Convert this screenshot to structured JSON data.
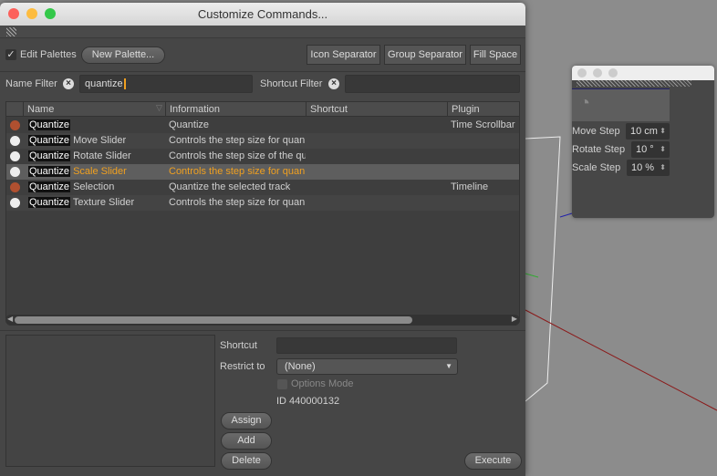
{
  "window": {
    "title": "Customize Commands..."
  },
  "toolbar": {
    "edit_palettes": "Edit Palettes",
    "edit_palettes_checked": true,
    "new_palette": "New Palette...",
    "icon_separator": "Icon Separator",
    "group_separator": "Group Separator",
    "fill_space": "Fill Space"
  },
  "filters": {
    "name_label": "Name Filter",
    "name_value": "quantize",
    "shortcut_label": "Shortcut Filter",
    "shortcut_value": ""
  },
  "table": {
    "columns": [
      "Name",
      "Information",
      "Shortcut",
      "Plugin"
    ],
    "rows": [
      {
        "icon": "timeline-icon",
        "prefix": "Quantize",
        "name": "",
        "info": "Quantize",
        "shortcut": "",
        "plugin": "Time Scrollbar"
      },
      {
        "icon": "gear-icon",
        "prefix": "Quantize",
        "name": "Move Slider",
        "info": "Controls the step size for quan",
        "shortcut": "",
        "plugin": ""
      },
      {
        "icon": "gear-icon",
        "prefix": "Quantize",
        "name": "Rotate Slider",
        "info": "Controls the step size of the qu",
        "shortcut": "",
        "plugin": ""
      },
      {
        "icon": "gear-icon",
        "prefix": "Quantize",
        "name": "Scale Slider",
        "info": "Controls the step size for quan",
        "shortcut": "",
        "plugin": "",
        "selected": true
      },
      {
        "icon": "timeline-icon",
        "prefix": "Quantize",
        "name": "Selection",
        "info": "Quantize the selected track",
        "shortcut": "",
        "plugin": "Timeline"
      },
      {
        "icon": "gear-icon",
        "prefix": "Quantize",
        "name": "Texture Slider",
        "info": "Controls the step size for quan",
        "shortcut": "",
        "plugin": ""
      }
    ]
  },
  "details": {
    "shortcut_label": "Shortcut",
    "shortcut_value": "",
    "restrict_label": "Restrict to",
    "restrict_value": "(None)",
    "options_mode": "Options Mode",
    "id_text": "ID 440000132",
    "assign": "Assign",
    "add": "Add",
    "delete": "Delete",
    "execute": "Execute"
  },
  "palette": {
    "move_label": "Move Step",
    "move_value": "10 cm",
    "rotate_label": "Rotate Step",
    "rotate_value": "10 °",
    "scale_label": "Scale Step",
    "scale_value": "10 %"
  },
  "colors": {
    "accent": "#f0a020",
    "selected_row": "#5e5e5e"
  }
}
